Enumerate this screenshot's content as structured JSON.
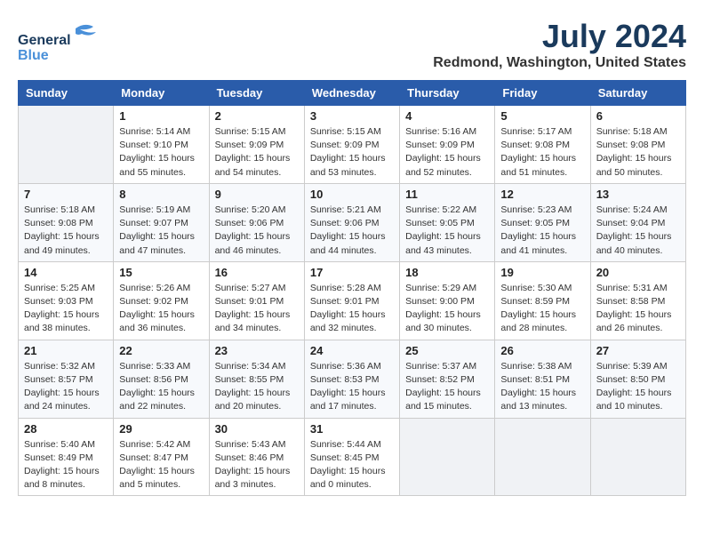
{
  "header": {
    "logo_line1": "General",
    "logo_line2": "Blue",
    "month_year": "July 2024",
    "location": "Redmond, Washington, United States"
  },
  "days_of_week": [
    "Sunday",
    "Monday",
    "Tuesday",
    "Wednesday",
    "Thursday",
    "Friday",
    "Saturday"
  ],
  "weeks": [
    [
      {
        "day": "",
        "info": ""
      },
      {
        "day": "1",
        "info": "Sunrise: 5:14 AM\nSunset: 9:10 PM\nDaylight: 15 hours\nand 55 minutes."
      },
      {
        "day": "2",
        "info": "Sunrise: 5:15 AM\nSunset: 9:09 PM\nDaylight: 15 hours\nand 54 minutes."
      },
      {
        "day": "3",
        "info": "Sunrise: 5:15 AM\nSunset: 9:09 PM\nDaylight: 15 hours\nand 53 minutes."
      },
      {
        "day": "4",
        "info": "Sunrise: 5:16 AM\nSunset: 9:09 PM\nDaylight: 15 hours\nand 52 minutes."
      },
      {
        "day": "5",
        "info": "Sunrise: 5:17 AM\nSunset: 9:08 PM\nDaylight: 15 hours\nand 51 minutes."
      },
      {
        "day": "6",
        "info": "Sunrise: 5:18 AM\nSunset: 9:08 PM\nDaylight: 15 hours\nand 50 minutes."
      }
    ],
    [
      {
        "day": "7",
        "info": "Sunrise: 5:18 AM\nSunset: 9:08 PM\nDaylight: 15 hours\nand 49 minutes."
      },
      {
        "day": "8",
        "info": "Sunrise: 5:19 AM\nSunset: 9:07 PM\nDaylight: 15 hours\nand 47 minutes."
      },
      {
        "day": "9",
        "info": "Sunrise: 5:20 AM\nSunset: 9:06 PM\nDaylight: 15 hours\nand 46 minutes."
      },
      {
        "day": "10",
        "info": "Sunrise: 5:21 AM\nSunset: 9:06 PM\nDaylight: 15 hours\nand 44 minutes."
      },
      {
        "day": "11",
        "info": "Sunrise: 5:22 AM\nSunset: 9:05 PM\nDaylight: 15 hours\nand 43 minutes."
      },
      {
        "day": "12",
        "info": "Sunrise: 5:23 AM\nSunset: 9:05 PM\nDaylight: 15 hours\nand 41 minutes."
      },
      {
        "day": "13",
        "info": "Sunrise: 5:24 AM\nSunset: 9:04 PM\nDaylight: 15 hours\nand 40 minutes."
      }
    ],
    [
      {
        "day": "14",
        "info": "Sunrise: 5:25 AM\nSunset: 9:03 PM\nDaylight: 15 hours\nand 38 minutes."
      },
      {
        "day": "15",
        "info": "Sunrise: 5:26 AM\nSunset: 9:02 PM\nDaylight: 15 hours\nand 36 minutes."
      },
      {
        "day": "16",
        "info": "Sunrise: 5:27 AM\nSunset: 9:01 PM\nDaylight: 15 hours\nand 34 minutes."
      },
      {
        "day": "17",
        "info": "Sunrise: 5:28 AM\nSunset: 9:01 PM\nDaylight: 15 hours\nand 32 minutes."
      },
      {
        "day": "18",
        "info": "Sunrise: 5:29 AM\nSunset: 9:00 PM\nDaylight: 15 hours\nand 30 minutes."
      },
      {
        "day": "19",
        "info": "Sunrise: 5:30 AM\nSunset: 8:59 PM\nDaylight: 15 hours\nand 28 minutes."
      },
      {
        "day": "20",
        "info": "Sunrise: 5:31 AM\nSunset: 8:58 PM\nDaylight: 15 hours\nand 26 minutes."
      }
    ],
    [
      {
        "day": "21",
        "info": "Sunrise: 5:32 AM\nSunset: 8:57 PM\nDaylight: 15 hours\nand 24 minutes."
      },
      {
        "day": "22",
        "info": "Sunrise: 5:33 AM\nSunset: 8:56 PM\nDaylight: 15 hours\nand 22 minutes."
      },
      {
        "day": "23",
        "info": "Sunrise: 5:34 AM\nSunset: 8:55 PM\nDaylight: 15 hours\nand 20 minutes."
      },
      {
        "day": "24",
        "info": "Sunrise: 5:36 AM\nSunset: 8:53 PM\nDaylight: 15 hours\nand 17 minutes."
      },
      {
        "day": "25",
        "info": "Sunrise: 5:37 AM\nSunset: 8:52 PM\nDaylight: 15 hours\nand 15 minutes."
      },
      {
        "day": "26",
        "info": "Sunrise: 5:38 AM\nSunset: 8:51 PM\nDaylight: 15 hours\nand 13 minutes."
      },
      {
        "day": "27",
        "info": "Sunrise: 5:39 AM\nSunset: 8:50 PM\nDaylight: 15 hours\nand 10 minutes."
      }
    ],
    [
      {
        "day": "28",
        "info": "Sunrise: 5:40 AM\nSunset: 8:49 PM\nDaylight: 15 hours\nand 8 minutes."
      },
      {
        "day": "29",
        "info": "Sunrise: 5:42 AM\nSunset: 8:47 PM\nDaylight: 15 hours\nand 5 minutes."
      },
      {
        "day": "30",
        "info": "Sunrise: 5:43 AM\nSunset: 8:46 PM\nDaylight: 15 hours\nand 3 minutes."
      },
      {
        "day": "31",
        "info": "Sunrise: 5:44 AM\nSunset: 8:45 PM\nDaylight: 15 hours\nand 0 minutes."
      },
      {
        "day": "",
        "info": ""
      },
      {
        "day": "",
        "info": ""
      },
      {
        "day": "",
        "info": ""
      }
    ]
  ]
}
